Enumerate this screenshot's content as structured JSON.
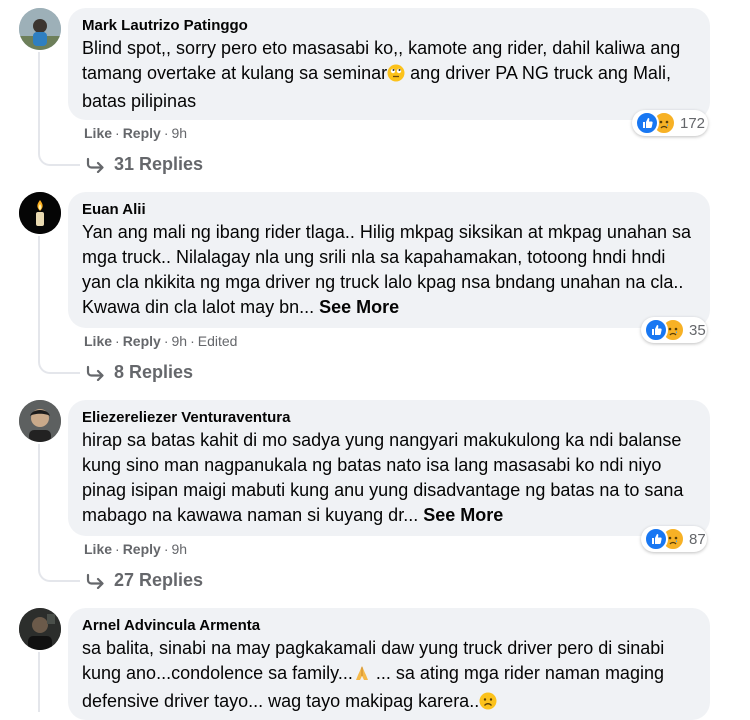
{
  "comments": [
    {
      "author": "Mark Lautrizo Patinggo",
      "text_parts": [
        "Blind spot,, sorry pero eto masasabi ko,, kamote ang rider, dahil kaliwa ang tamang overtake at kulang sa seminar",
        " ang driver PA NG truck ang Mali, batas pilipinas"
      ],
      "like": "Like",
      "reply": "Reply",
      "time": "9h",
      "edited": "",
      "reactions": "172",
      "replies": "31 Replies",
      "see_more": ""
    },
    {
      "author": "Euan Alii",
      "text_parts": [
        "Yan ang mali ng ibang rider tlaga.. Hilig mkpag siksikan at mkpag unahan sa mga truck.. Nilalagay nla ung srili nla sa kapahamakan, totoong hndi hndi yan cla nkikita ng mga driver ng truck lalo kpag nsa bndang unahan na cla.. Kwawa din cla lalot may bn..."
      ],
      "like": "Like",
      "reply": "Reply",
      "time": "9h",
      "edited": "Edited",
      "reactions": "35",
      "replies": "8 Replies",
      "see_more": "See More"
    },
    {
      "author": "Eliezereliezer Venturaventura",
      "text_parts": [
        "hirap sa batas kahit di mo sadya yung nangyari makukulong ka ndi balanse kung sino man nagpanukala ng batas nato isa lang masasabi ko ndi niyo pinag isipan maigi mabuti kung anu yung disadvantage ng batas na to sana mabago na kawawa naman si kuyang dr..."
      ],
      "like": "Like",
      "reply": "Reply",
      "time": "9h",
      "edited": "",
      "reactions": "87",
      "replies": "27 Replies",
      "see_more": "See More"
    },
    {
      "author": "Arnel Advincula Armenta",
      "text_parts": [
        "sa balita, sinabi na may pagkakamali daw yung truck driver pero di sinabi kung ano...condolence sa family...",
        " ... sa ating mga rider naman maging defensive driver tayo... wag tayo makipag karera.."
      ]
    }
  ],
  "separator": "·",
  "colors": {
    "bubble": "#f0f2f5",
    "meta": "#65676b",
    "like_blue": "#1877f2",
    "sad_yellow": "#f7b125"
  },
  "icons": [
    "reply-arrow-icon",
    "like-reaction-icon",
    "sad-reaction-icon",
    "rolling-eyes-emoji",
    "praying-hands-emoji",
    "sad-face-emoji"
  ]
}
